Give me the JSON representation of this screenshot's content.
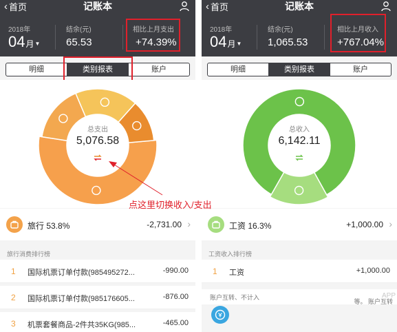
{
  "colors": {
    "header": "#3c3d42",
    "annotation": "#e0202b",
    "expense_segments": [
      "#f0a04b",
      "#e98c2e",
      "#f5c45a",
      "#f6a64e"
    ],
    "income_main": "#6cc24a",
    "income_light": "#a6dd7f"
  },
  "left": {
    "nav": {
      "back_label": "首页",
      "title": "记账本",
      "user_icon": "user-icon"
    },
    "stats": {
      "year": "2018年",
      "month_number": "04",
      "month_unit": "月",
      "balance_label": "结余(元)",
      "balance_value": "65.53",
      "compare_label": "相比上月支出",
      "compare_value": "+74.39%"
    },
    "tabs": [
      "明细",
      "类别报表",
      "账户"
    ],
    "active_tab": "类别报表",
    "chart_data": {
      "type": "pie",
      "title": "",
      "center_label": "总支出",
      "center_value": "5,076.58",
      "slices": [
        {
          "name": "旅行",
          "value": 53.8,
          "icon": "lock-icon"
        },
        {
          "name": "",
          "value": 12.0,
          "icon": "bag-icon"
        },
        {
          "name": "",
          "value": 18.0,
          "icon": "money-icon"
        },
        {
          "name": "",
          "value": 16.2,
          "icon": ""
        }
      ]
    },
    "selected": {
      "name": "旅行 53.8%",
      "amount": "-2,731.00"
    },
    "ranking_title": "旅行消费排行榜",
    "ranking": [
      {
        "no": "1",
        "name": "国际机票订单付款(985495272...",
        "amount": "-990.00"
      },
      {
        "no": "2",
        "name": "国际机票订单付款(985176605...",
        "amount": "-876.00"
      },
      {
        "no": "3",
        "name": "机票套餐商品-2件共35KG(985...",
        "amount": "-465.00"
      }
    ],
    "annotation": "点这里切换收入/支出"
  },
  "right": {
    "nav": {
      "back_label": "首页",
      "title": "记账本",
      "user_icon": "user-icon"
    },
    "stats": {
      "year": "2018年",
      "month_number": "04",
      "month_unit": "月",
      "balance_label": "结余(元)",
      "balance_value": "1,065.53",
      "compare_label": "相比上月收入",
      "compare_value": "+767.04%"
    },
    "tabs": [
      "明细",
      "类别报表",
      "账户"
    ],
    "active_tab": "类别报表",
    "chart_data": {
      "type": "pie",
      "title": "",
      "center_label": "总收入",
      "center_value": "6,142.11",
      "slices": [
        {
          "name": "工资",
          "value": 16.3,
          "icon": "briefcase-icon"
        },
        {
          "name": "",
          "value": 83.7,
          "icon": "money-bag-icon"
        }
      ]
    },
    "selected": {
      "name": "工资 16.3%",
      "amount": "+1,000.00"
    },
    "ranking_title": "工资收入排行榜",
    "ranking": [
      {
        "no": "1",
        "name": "工资",
        "amount": "+1,000.00"
      }
    ],
    "transfer_left": "账户互转、不计入",
    "transfer_right": "等。     账户互转",
    "watermark": "APP"
  }
}
